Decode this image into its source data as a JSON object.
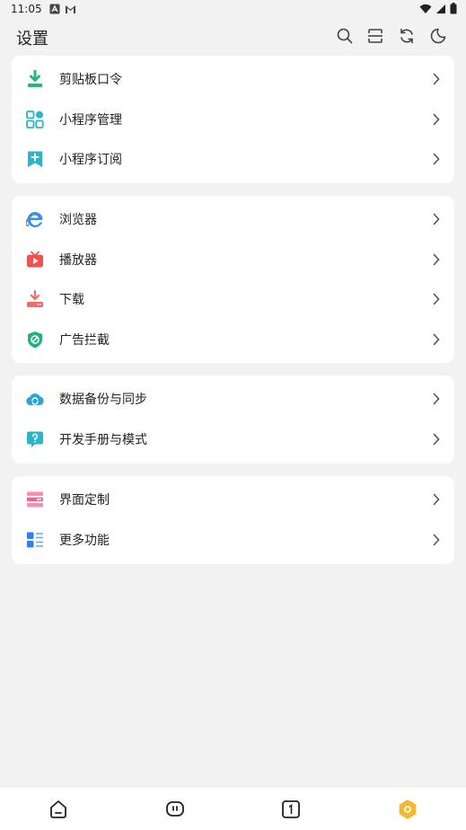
{
  "status": {
    "time": "11:05"
  },
  "header": {
    "title": "设置"
  },
  "groups": [
    {
      "items": [
        {
          "label": "剪贴板口令",
          "icon": "clipboard-download-icon",
          "color": "#2ab57d"
        },
        {
          "label": "小程序管理",
          "icon": "grid-apps-icon",
          "color": "#29b6c6"
        },
        {
          "label": "小程序订阅",
          "icon": "bookmark-plus-icon",
          "color": "#29b6c6"
        }
      ]
    },
    {
      "items": [
        {
          "label": "浏览器",
          "icon": "browser-e-icon",
          "color": "#3d8fe0"
        },
        {
          "label": "播放器",
          "icon": "tv-play-icon",
          "color": "#ef5350"
        },
        {
          "label": "下载",
          "icon": "download-icon",
          "color": "#ef6b6b"
        },
        {
          "label": "广告拦截",
          "icon": "shield-block-icon",
          "color": "#1fb27a"
        }
      ]
    },
    {
      "items": [
        {
          "label": "数据备份与同步",
          "icon": "cloud-sync-icon",
          "color": "#29a3d6"
        },
        {
          "label": "开发手册与模式",
          "icon": "help-bubble-icon",
          "color": "#29b6c6"
        }
      ]
    },
    {
      "items": [
        {
          "label": "界面定制",
          "icon": "layout-icon",
          "color": "#f06292"
        },
        {
          "label": "更多功能",
          "icon": "list-more-icon",
          "color": "#2f80ed"
        }
      ]
    }
  ],
  "tabs": {
    "active_color": "#f5b82e"
  }
}
